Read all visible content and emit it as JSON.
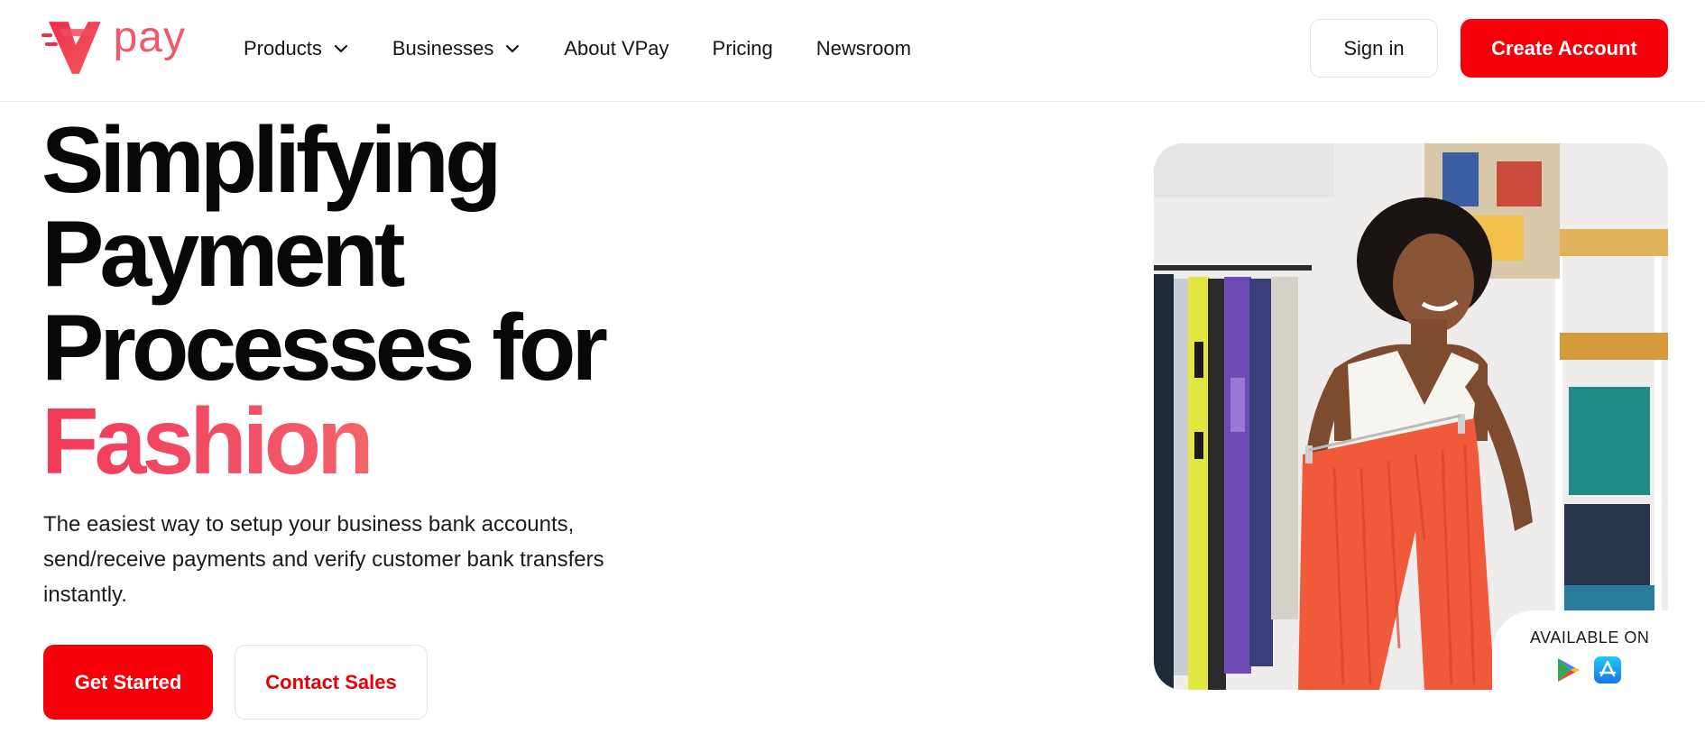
{
  "brand": {
    "name": "pay",
    "colors": {
      "primary": "#f5000a",
      "accent_gradient_start": "#f23a57",
      "accent_gradient_end": "#f79a56"
    }
  },
  "nav": {
    "items": [
      {
        "label": "Products",
        "has_dropdown": true,
        "icon": "chevron-down-icon"
      },
      {
        "label": "Businesses",
        "has_dropdown": true,
        "icon": "chevron-down-icon"
      },
      {
        "label": "About VPay",
        "has_dropdown": false
      },
      {
        "label": "Pricing",
        "has_dropdown": false
      },
      {
        "label": "Newsroom",
        "has_dropdown": false
      }
    ],
    "sign_in_label": "Sign in",
    "create_account_label": "Create Account"
  },
  "hero": {
    "title_lines": [
      "Simplifying",
      "Payment",
      "Processes for"
    ],
    "title_accent": "Fashion",
    "subtitle": "The easiest way to setup your business bank accounts, send/receive payments and verify customer bank transfers instantly.",
    "get_started_label": "Get Started",
    "contact_sales_label": "Contact Sales"
  },
  "app_badge": {
    "label": "AVAILABLE ON",
    "icons": [
      "google-play-icon",
      "app-store-icon"
    ]
  }
}
